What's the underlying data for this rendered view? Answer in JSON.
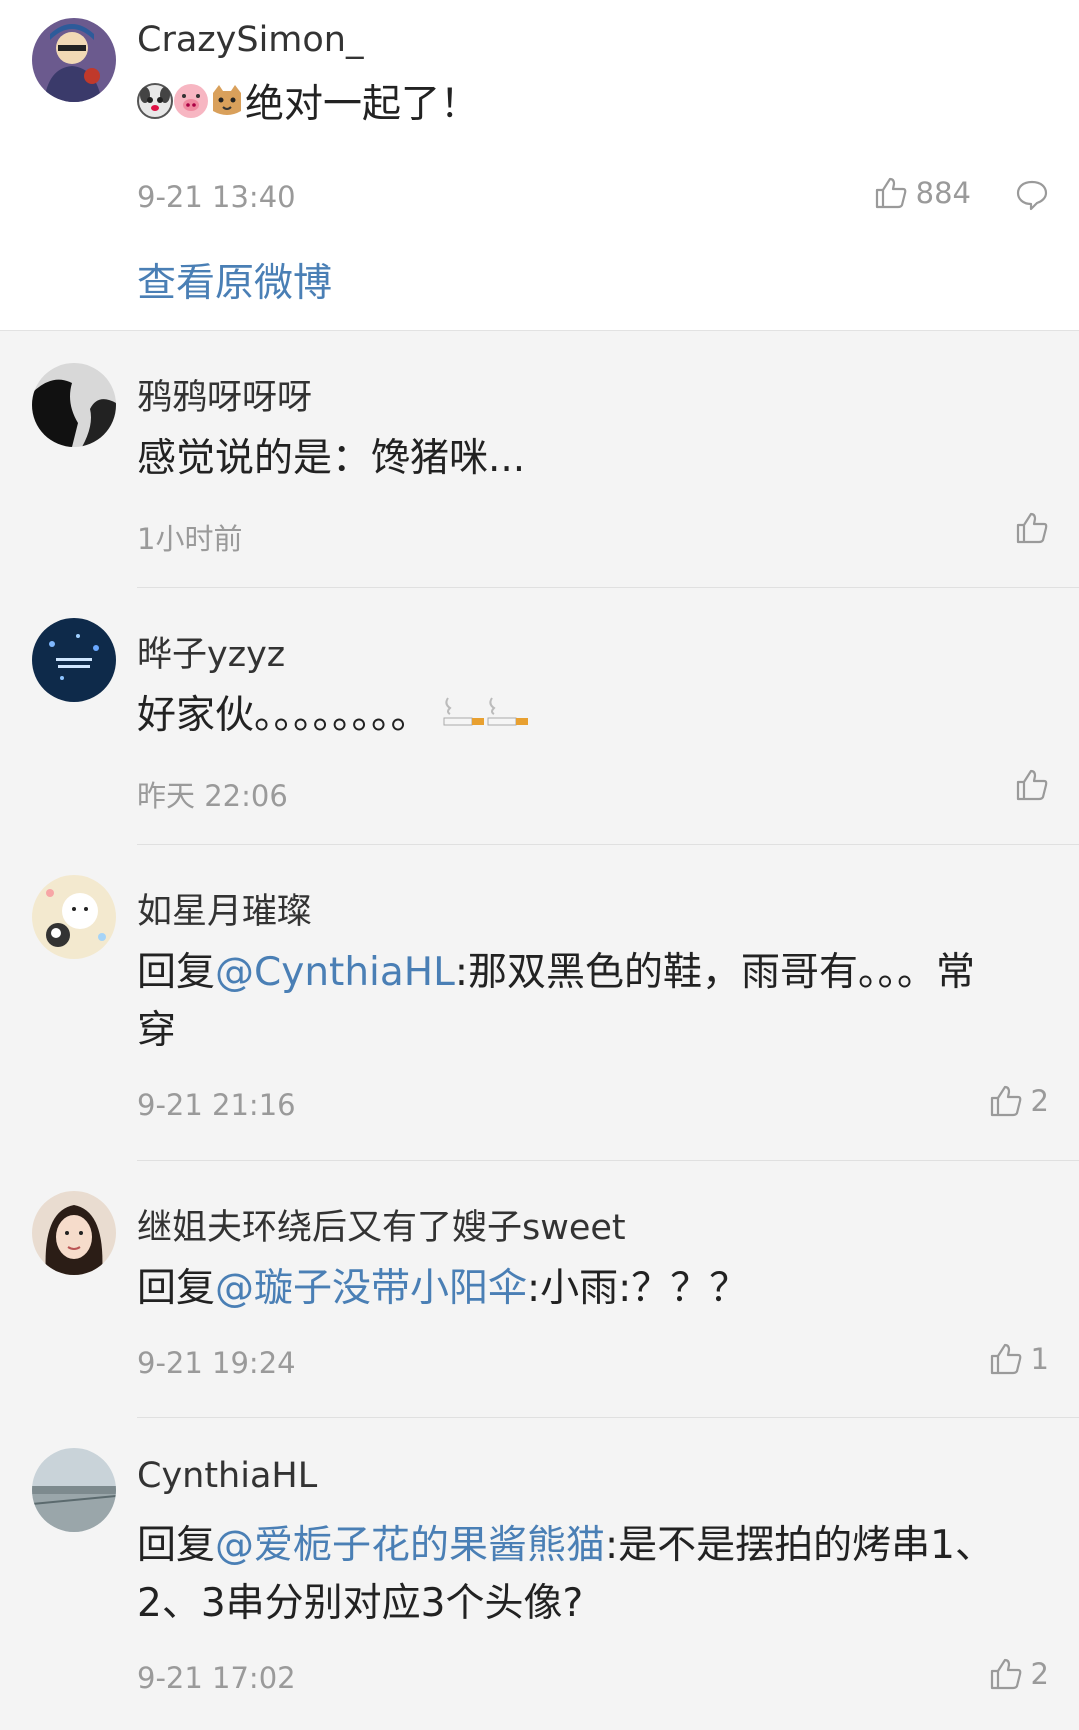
{
  "original_post": {
    "username": "CrazySimon_",
    "text": "绝对一起了！",
    "timestamp": "9-21 13:40",
    "likes": "884",
    "view_original_label": "查看原微博"
  },
  "comments": [
    {
      "username": "鸦鸦呀呀呀",
      "text": "感觉说的是：馋猪咪...",
      "timestamp": "1小时前",
      "likes": ""
    },
    {
      "username": "晔子yzyz",
      "text": "好家伙。。。。。。。。",
      "timestamp": "昨天 22:06",
      "likes": ""
    },
    {
      "username": "如星月璀璨",
      "reply_prefix": "回复",
      "mention": "@CynthiaHL",
      "text_line1": ":那双黑色的鞋，雨哥有。。。常",
      "text_line2": "穿",
      "timestamp": "9-21 21:16",
      "likes": "2"
    },
    {
      "username": "继姐夫环绕后又有了嫂子sweet",
      "reply_prefix": "回复",
      "mention": "@璇子没带小阳伞",
      "text": ":小雨:？？？",
      "timestamp": "9-21 19:24",
      "likes": "1"
    },
    {
      "username": "CynthiaHL",
      "reply_prefix": "回复",
      "mention": "@爱栀子花的果酱熊猫",
      "text_line1": ":是不是摆拍的烤串1、",
      "text_line2": "2、3串分别对应3个头像?",
      "timestamp": "9-21 17:02",
      "likes": "2"
    }
  ],
  "colors": {
    "link": "#4a7fb5",
    "meta": "#9a9a9a",
    "background": "#f4f4f4"
  },
  "icons": [
    "like-icon",
    "comment-icon",
    "cigarette-icon",
    "dog-emoji-icon",
    "pig-emoji-icon",
    "cat-emoji-icon"
  ]
}
